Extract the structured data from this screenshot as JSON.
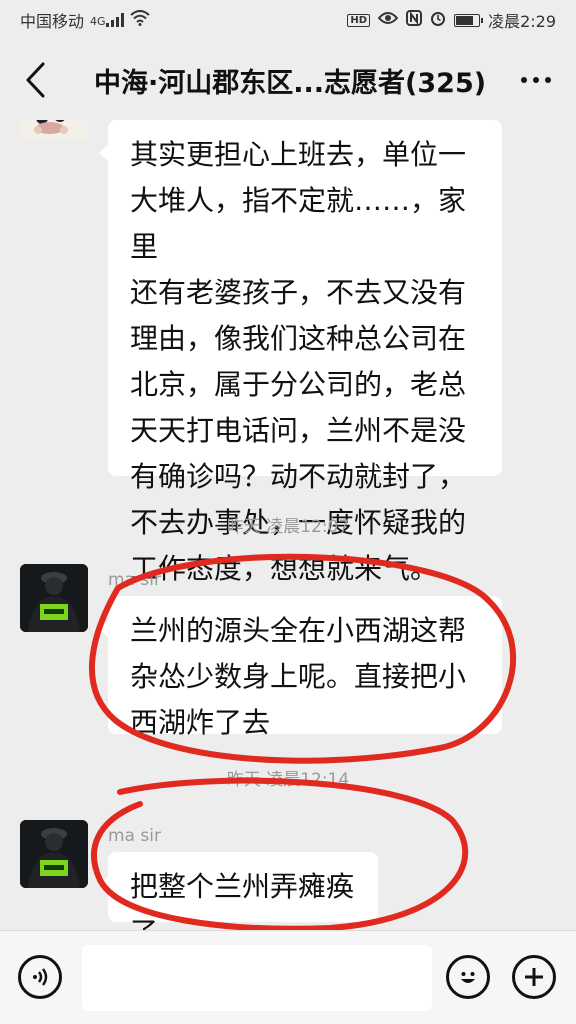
{
  "status_bar": {
    "carrier": "中国移动",
    "network": "4G",
    "hd_badge": "HD",
    "time": "凌晨2:29",
    "battery_level_percent": 80,
    "icons": [
      "signal-icon",
      "wifi-icon",
      "hd-icon",
      "eye-icon",
      "nfc-icon",
      "alarm-icon",
      "battery-icon"
    ]
  },
  "header": {
    "title": "中海·河山郡东区...志愿者(325)",
    "back_icon": "chevron-left-icon",
    "more_icon": "more-dots-icon"
  },
  "messages": [
    {
      "sender": "",
      "text_lines": [
        "其实更担心上班去，单位一",
        "大堆人，指不定就……，家里",
        "还有老婆孩子，不去又没有",
        "理由，像我们这种总公司在",
        "北京，属于分公司的，老总",
        "天天打电话问，兰州不是没",
        "有确诊吗？动不动就封了，",
        "不去办事处，一度怀疑我的",
        "工作态度，想想就来气。"
      ]
    },
    {
      "timestamp": "昨天 凌晨12:07"
    },
    {
      "sender": "ma sir",
      "text_lines": [
        "兰州的源头全在小西湖这帮",
        "杂怂少数身上呢。直接把小",
        "西湖炸了去"
      ]
    },
    {
      "timestamp": "昨天 凌晨12:14"
    },
    {
      "sender": "ma sir",
      "text_lines": [
        "把整个兰州弄瘫痪了"
      ]
    }
  ],
  "input_bar": {
    "voice_icon": "voice-icon",
    "emoji_icon": "emoji-icon",
    "plus_icon": "plus-icon",
    "input_value": ""
  },
  "colors": {
    "background": "#ededed",
    "bubble": "#ffffff",
    "annotation_red": "#e0291f",
    "muted_text": "#999999"
  }
}
